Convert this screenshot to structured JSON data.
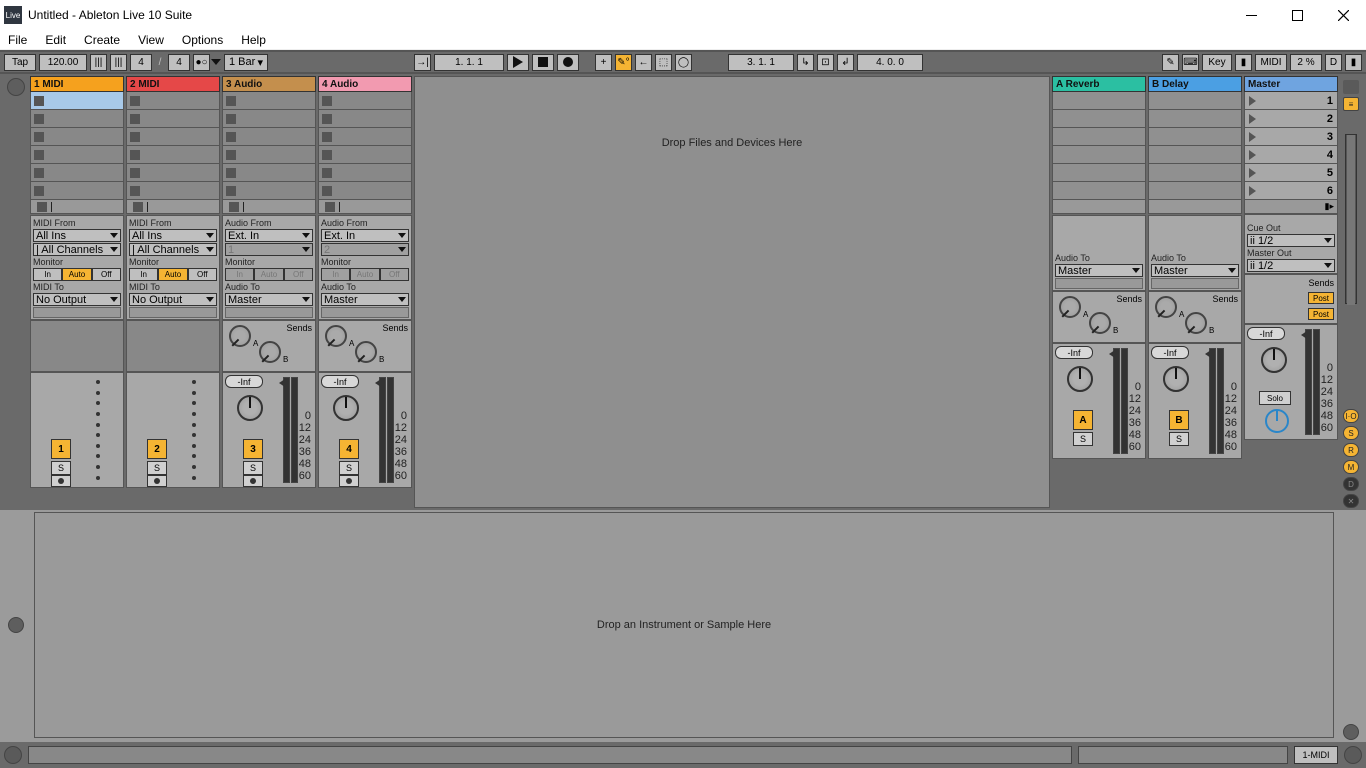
{
  "window": {
    "title": "Untitled - Ableton Live 10 Suite",
    "icon_label": "Live"
  },
  "menu": [
    "File",
    "Edit",
    "Create",
    "View",
    "Options",
    "Help"
  ],
  "topbar": {
    "tap": "Tap",
    "tempo": "120.00",
    "sig_num": "4",
    "sig_den": "4",
    "quantize": "1 Bar",
    "position": "1.  1.  1",
    "arr_position": "3.  1.  1",
    "loop_len": "4.  0.  0",
    "key": "Key",
    "midi": "MIDI",
    "cpu": "2 %",
    "disk": "D"
  },
  "tracks": [
    {
      "name": "1 MIDI",
      "cls": "t-orange",
      "type": "midi",
      "from": "MIDI From",
      "from_v": "All Ins",
      "from2": "All Channels",
      "to": "MIDI To",
      "to_v": "No Output",
      "arm": "1",
      "inf": null,
      "highlight": true
    },
    {
      "name": "2 MIDI",
      "cls": "t-red",
      "type": "midi",
      "from": "MIDI From",
      "from_v": "All Ins",
      "from2": "All Channels",
      "to": "MIDI To",
      "to_v": "No Output",
      "arm": "2",
      "inf": null
    },
    {
      "name": "3 Audio",
      "cls": "t-brown",
      "type": "audio",
      "from": "Audio From",
      "from_v": "Ext. In",
      "from2": "1",
      "to": "Audio To",
      "to_v": "Master",
      "arm": "3",
      "inf": "-Inf"
    },
    {
      "name": "4 Audio",
      "cls": "t-pink",
      "type": "audio",
      "from": "Audio From",
      "from_v": "Ext. In",
      "from2": "2",
      "to": "Audio To",
      "to_v": "Master",
      "arm": "4",
      "inf": "-Inf"
    }
  ],
  "drop_main": "Drop Files and Devices Here",
  "returns": [
    {
      "name": "A Reverb",
      "cls": "t-return-a",
      "to": "Audio To",
      "to_v": "Master",
      "arm": "A",
      "inf": "-Inf"
    },
    {
      "name": "B Delay",
      "cls": "t-return-b",
      "to": "Audio To",
      "to_v": "Master",
      "arm": "B",
      "inf": "-Inf"
    }
  ],
  "master": {
    "name": "Master",
    "cue": "Cue Out",
    "cue_v": "ii 1/2",
    "out": "Master Out",
    "out_v": "ii 1/2",
    "sends": "Sends",
    "post": "Post",
    "solo": "Solo",
    "inf": "-Inf"
  },
  "scenes": [
    "1",
    "2",
    "3",
    "4",
    "5",
    "6"
  ],
  "labels": {
    "monitor": "Monitor",
    "in": "In",
    "auto": "Auto",
    "off": "Off",
    "sends": "Sends",
    "s": "S",
    "a": "A",
    "b": "B"
  },
  "meter_ticks": [
    "0",
    "12",
    "24",
    "36",
    "48",
    "60"
  ],
  "drop_device": "Drop an Instrument or Sample Here",
  "status_target": "1-MIDI"
}
